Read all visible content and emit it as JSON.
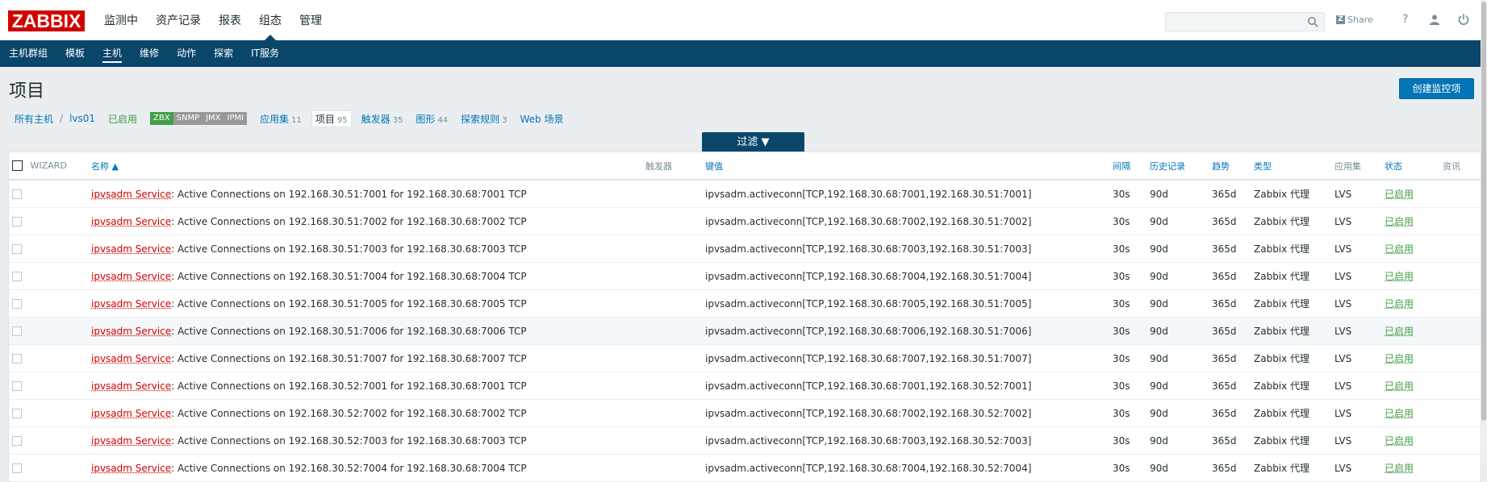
{
  "logo": "ZABBIX",
  "main_menu": [
    "监测中",
    "资产记录",
    "报表",
    "组态",
    "管理"
  ],
  "main_menu_active": 3,
  "top_right": {
    "share_label": "Share",
    "help_glyph": "?",
    "search_value": ""
  },
  "sub_menu": [
    "主机群组",
    "模板",
    "主机",
    "维修",
    "动作",
    "探索",
    "IT服务"
  ],
  "sub_menu_active": 2,
  "page_title": "项目",
  "create_button": "创建监控项",
  "breadcrumb": {
    "all_hosts": "所有主机",
    "sep": "/",
    "host": "lvs01",
    "status": "已启用",
    "avail": [
      {
        "label": "ZBX",
        "state": "on"
      },
      {
        "label": "SNMP",
        "state": "off"
      },
      {
        "label": "JMX",
        "state": "off"
      },
      {
        "label": "IPMI",
        "state": "off"
      }
    ],
    "tabs": [
      {
        "label": "应用集",
        "count": "11"
      },
      {
        "label": "项目",
        "count": "95",
        "current": true
      },
      {
        "label": "触发器",
        "count": "35"
      },
      {
        "label": "图形",
        "count": "44"
      },
      {
        "label": "探索规则",
        "count": "3"
      },
      {
        "label": "Web 场景",
        "count": ""
      }
    ]
  },
  "filter_label": "过滤 ▼",
  "table": {
    "headers": {
      "wizard": "WIZARD",
      "name": "名称 ▲",
      "triggers": "触发器",
      "key": "键值",
      "interval": "间隔",
      "history": "历史记录",
      "trends": "趋势",
      "type": "类型",
      "apps": "应用集",
      "status": "状态",
      "info": "资讯"
    },
    "rows": [
      {
        "app": "ipvsadm Service",
        "name": ": Active Connections on 192.168.30.51:7001 for 192.168.30.68:7001 TCP",
        "key": "ipvsadm.activeconn[TCP,192.168.30.68:7001,192.168.30.51:7001]",
        "interval": "30s",
        "history": "90d",
        "trends": "365d",
        "type": "Zabbix 代理",
        "apps": "LVS",
        "status": "已启用"
      },
      {
        "app": "ipvsadm Service",
        "name": ": Active Connections on 192.168.30.51:7002 for 192.168.30.68:7002 TCP",
        "key": "ipvsadm.activeconn[TCP,192.168.30.68:7002,192.168.30.51:7002]",
        "interval": "30s",
        "history": "90d",
        "trends": "365d",
        "type": "Zabbix 代理",
        "apps": "LVS",
        "status": "已启用"
      },
      {
        "app": "ipvsadm Service",
        "name": ": Active Connections on 192.168.30.51:7003 for 192.168.30.68:7003 TCP",
        "key": "ipvsadm.activeconn[TCP,192.168.30.68:7003,192.168.30.51:7003]",
        "interval": "30s",
        "history": "90d",
        "trends": "365d",
        "type": "Zabbix 代理",
        "apps": "LVS",
        "status": "已启用"
      },
      {
        "app": "ipvsadm Service",
        "name": ": Active Connections on 192.168.30.51:7004 for 192.168.30.68:7004 TCP",
        "key": "ipvsadm.activeconn[TCP,192.168.30.68:7004,192.168.30.51:7004]",
        "interval": "30s",
        "history": "90d",
        "trends": "365d",
        "type": "Zabbix 代理",
        "apps": "LVS",
        "status": "已启用"
      },
      {
        "app": "ipvsadm Service",
        "name": ": Active Connections on 192.168.30.51:7005 for 192.168.30.68:7005 TCP",
        "key": "ipvsadm.activeconn[TCP,192.168.30.68:7005,192.168.30.51:7005]",
        "interval": "30s",
        "history": "90d",
        "trends": "365d",
        "type": "Zabbix 代理",
        "apps": "LVS",
        "status": "已启用"
      },
      {
        "app": "ipvsadm Service",
        "name": ": Active Connections on 192.168.30.51:7006 for 192.168.30.68:7006 TCP",
        "key": "ipvsadm.activeconn[TCP,192.168.30.68:7006,192.168.30.51:7006]",
        "interval": "30s",
        "history": "90d",
        "trends": "365d",
        "type": "Zabbix 代理",
        "apps": "LVS",
        "status": "已启用",
        "highlight": true
      },
      {
        "app": "ipvsadm Service",
        "name": ": Active Connections on 192.168.30.51:7007 for 192.168.30.68:7007 TCP",
        "key": "ipvsadm.activeconn[TCP,192.168.30.68:7007,192.168.30.51:7007]",
        "interval": "30s",
        "history": "90d",
        "trends": "365d",
        "type": "Zabbix 代理",
        "apps": "LVS",
        "status": "已启用"
      },
      {
        "app": "ipvsadm Service",
        "name": ": Active Connections on 192.168.30.52:7001 for 192.168.30.68:7001 TCP",
        "key": "ipvsadm.activeconn[TCP,192.168.30.68:7001,192.168.30.52:7001]",
        "interval": "30s",
        "history": "90d",
        "trends": "365d",
        "type": "Zabbix 代理",
        "apps": "LVS",
        "status": "已启用"
      },
      {
        "app": "ipvsadm Service",
        "name": ": Active Connections on 192.168.30.52:7002 for 192.168.30.68:7002 TCP",
        "key": "ipvsadm.activeconn[TCP,192.168.30.68:7002,192.168.30.52:7002]",
        "interval": "30s",
        "history": "90d",
        "trends": "365d",
        "type": "Zabbix 代理",
        "apps": "LVS",
        "status": "已启用"
      },
      {
        "app": "ipvsadm Service",
        "name": ": Active Connections on 192.168.30.52:7003 for 192.168.30.68:7003 TCP",
        "key": "ipvsadm.activeconn[TCP,192.168.30.68:7003,192.168.30.52:7003]",
        "interval": "30s",
        "history": "90d",
        "trends": "365d",
        "type": "Zabbix 代理",
        "apps": "LVS",
        "status": "已启用"
      },
      {
        "app": "ipvsadm Service",
        "name": ": Active Connections on 192.168.30.52:7004 for 192.168.30.68:7004 TCP",
        "key": "ipvsadm.activeconn[TCP,192.168.30.68:7004,192.168.30.52:7004]",
        "interval": "30s",
        "history": "90d",
        "trends": "365d",
        "type": "Zabbix 代理",
        "apps": "LVS",
        "status": "已启用"
      }
    ]
  }
}
